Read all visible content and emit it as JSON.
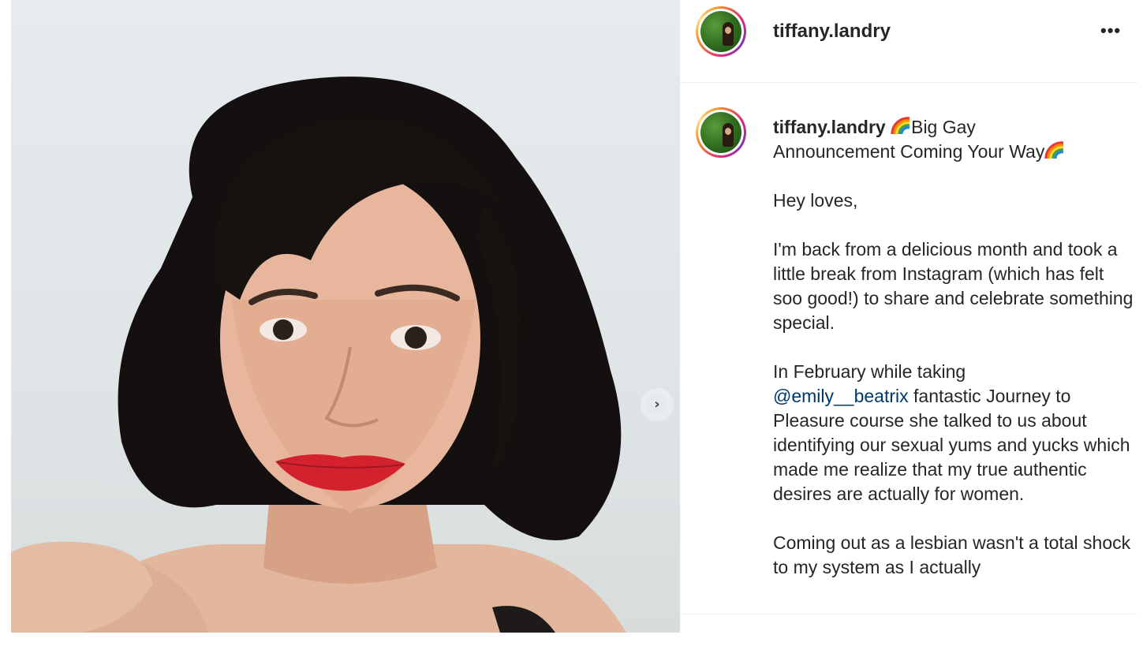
{
  "post": {
    "username": "tiffany.landry",
    "more_label": "•••",
    "next_label": "›",
    "caption": {
      "title_part1": "Big Gay",
      "title_part2": "Announcement Coming Your Way",
      "greeting": "Hey loves,",
      "para1": "I'm back from a delicious month and took a little break from Instagram (which has felt soo good!) to share and celebrate something special.",
      "para2_before": "In February while taking",
      "mention": "@emily__beatrix",
      "para2_after": "fantastic Journey to Pleasure course she talked to us about identifying our sexual yums and yucks which made me realize that my true authentic desires are actually for women.",
      "para3": "Coming out as a lesbian wasn't a total shock to my system as I actually"
    }
  },
  "icons": {
    "next": "chevron-right-icon",
    "more": "more-horizontal-icon",
    "rainbow": "rainbow-emoji-icon"
  },
  "colors": {
    "mention": "#00376b",
    "text": "#262626",
    "decor_circle": "#e9d9cf"
  }
}
